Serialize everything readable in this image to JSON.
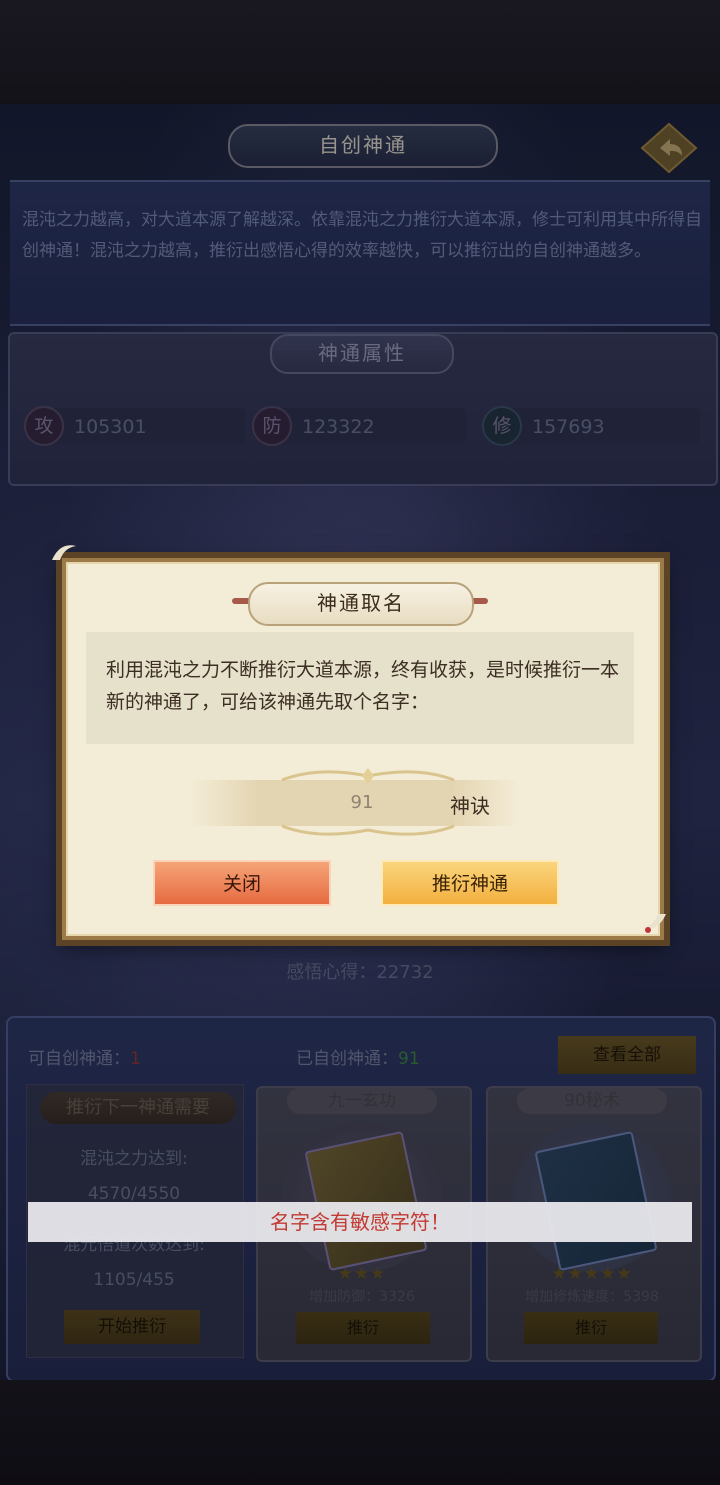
{
  "header": {
    "title": "自创神通"
  },
  "description": "混沌之力越高，对大道本源了解越深。依靠混沌之力推衍大道本源，修士可利用其中所得自创神通！混沌之力越高，推衍出感悟心得的效率越快，可以推衍出的自创神通越多。",
  "attributes": {
    "title": "神通属性",
    "items": [
      {
        "badge": "攻",
        "value": "105301"
      },
      {
        "badge": "防",
        "value": "123322"
      },
      {
        "badge": "修",
        "value": "157693"
      }
    ]
  },
  "insight": {
    "label": "感悟心得：",
    "value": "22732"
  },
  "summary": {
    "available_label": "可自创神通：",
    "available_value": "1",
    "created_label": "已自创神通：",
    "created_value": "91",
    "view_all": "查看全部"
  },
  "requirement": {
    "title": "推衍下一神通需要",
    "line1": "混沌之力达到:",
    "value1": "4570/4550",
    "line2": "混元悟道次数达到:",
    "value2": "1105/455",
    "button": "开始推衍"
  },
  "skills": [
    {
      "name": "九一玄功",
      "stars": "★★★",
      "effect": "增加防御：3326",
      "button": "推衍"
    },
    {
      "name": "90秘术",
      "stars": "★★★★★",
      "effect": "增加修炼速度：5398",
      "button": "推衍"
    }
  ],
  "toast": "名字含有敏感字符！",
  "dialog": {
    "title": "神通取名",
    "message": "利用混沌之力不断推衍大道本源，终有收获，是时候推衍一本新的神通了，可给该神通先取个名字：",
    "input_value": "91",
    "input_suffix": "神诀",
    "close_label": "关闭",
    "confirm_label": "推衍神通"
  },
  "colors": {
    "accent_orange": "#e6683e",
    "accent_gold": "#f2ae3d",
    "toast_text": "#c23a33",
    "panel_blue": "#2f3b6c"
  },
  "icons": [
    "back-arrow-icon",
    "book-icon"
  ]
}
